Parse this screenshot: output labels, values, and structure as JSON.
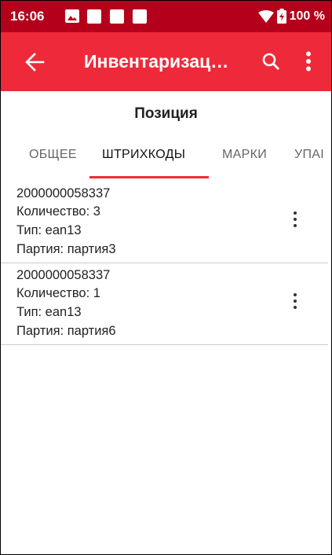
{
  "status_bar": {
    "time": "16:06",
    "battery": "100 %",
    "background": "#b4001b"
  },
  "app_bar": {
    "title": "Инвентаризац…",
    "background": "#ee2a3a",
    "back_icon": "arrow-left-icon",
    "search_icon": "search-icon",
    "menu_icon": "more-vert-icon"
  },
  "page": {
    "heading": "Позиция"
  },
  "tabs": [
    {
      "label": "ОБЩЕЕ",
      "active": false
    },
    {
      "label": "ШТРИХКОДЫ",
      "active": true
    },
    {
      "label": "МАРКИ",
      "active": false
    },
    {
      "label": "УПАІ",
      "active": false
    }
  ],
  "barcodes": [
    {
      "code": "2000000058337",
      "quantity": "Количество: 3",
      "type": "Тип: ean13",
      "batch": "Партия: партия3"
    },
    {
      "code": "2000000058337",
      "quantity": "Количество: 1",
      "type": "Тип: ean13",
      "batch": "Партия: партия6"
    }
  ]
}
